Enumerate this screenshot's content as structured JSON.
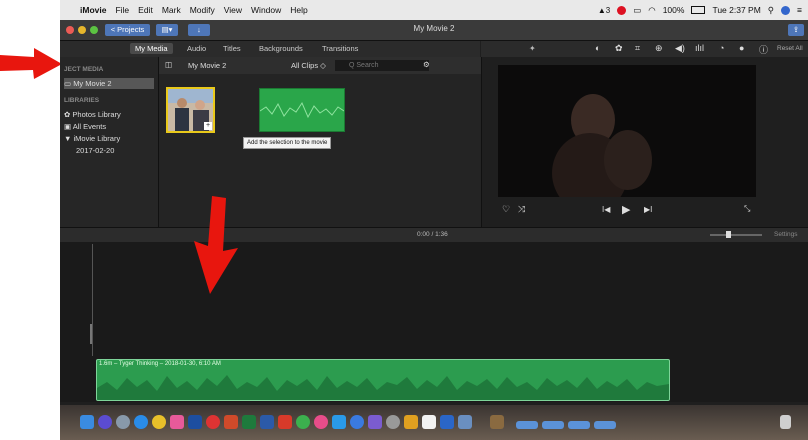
{
  "menubar": {
    "apple": "",
    "app_name": "iMovie",
    "menus": [
      "File",
      "Edit",
      "Mark",
      "Modify",
      "View",
      "Window",
      "Help"
    ],
    "battery": "100%",
    "clock": "Tue 2:37 PM"
  },
  "toolbar": {
    "projects_label": "< Projects",
    "window_title": "My Movie 2"
  },
  "tabs": [
    "My Media",
    "Audio",
    "Titles",
    "Backgrounds",
    "Transitions"
  ],
  "sidebar": {
    "project_media_header": "JECT MEDIA",
    "project_item": "My Movie 2",
    "libraries_header": "LIBRARIES",
    "items": [
      "Photos Library",
      "All Events",
      "▼ iMovie Library",
      "2017-02-20"
    ]
  },
  "browser": {
    "title": "My Movie 2",
    "filter": "All Clips ◇",
    "search_placeholder": "Q Search",
    "tooltip": "Add the selection to the movie"
  },
  "viewer": {
    "reset_all": "Reset All"
  },
  "timeline": {
    "time": "0:00 / 1:36",
    "settings": "Settings",
    "clip_label": "1.6m – Tyger Thinking – 2018-01-30, 6:10 AM"
  },
  "colors": {
    "clip_green": "#2c9c4f",
    "selection_yellow": "#e9c91a",
    "accent_blue": "#4e76b8",
    "arrow_red": "#e8160e"
  }
}
